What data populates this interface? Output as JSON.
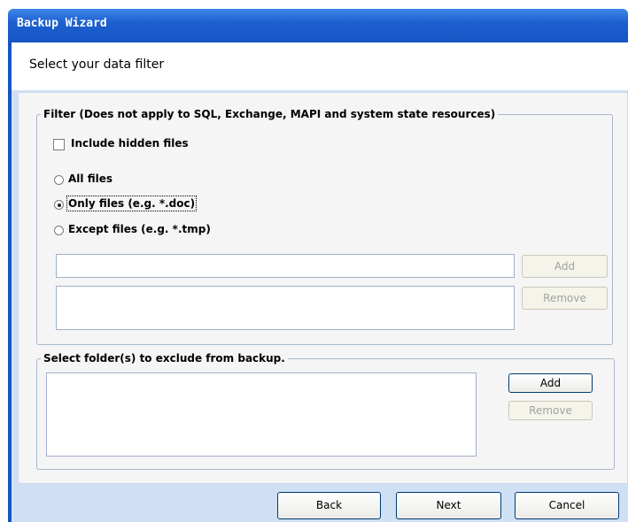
{
  "window": {
    "title": "Backup Wizard"
  },
  "header": {
    "title": "Select your data filter"
  },
  "filter_group": {
    "legend": "Filter (Does not apply to SQL, Exchange, MAPI and system state resources)",
    "include_hidden": {
      "label": "Include hidden files",
      "checked": false
    },
    "options": [
      {
        "label": "All files",
        "selected": false
      },
      {
        "label": "Only files (e.g. *.doc)",
        "selected": true
      },
      {
        "label": "Except files (e.g. *.tmp)",
        "selected": false
      }
    ],
    "pattern_input": {
      "value": ""
    },
    "add_label": "Add",
    "remove_label": "Remove"
  },
  "exclude_group": {
    "legend": "Select folder(s) to exclude from backup.",
    "add_label": "Add",
    "remove_label": "Remove"
  },
  "footer": {
    "back_label": "Back",
    "next_label": "Next",
    "cancel_label": "Cancel"
  }
}
